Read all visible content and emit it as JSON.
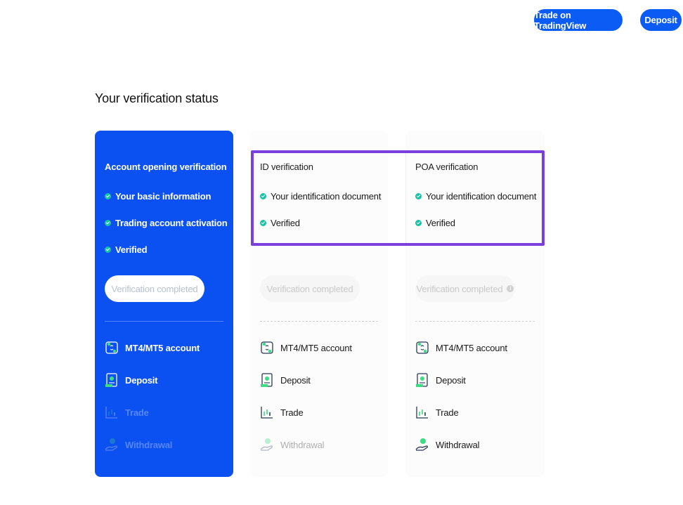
{
  "header": {
    "trade_button_label": "Trade on TradingView",
    "deposit_button_label": "Deposit"
  },
  "page": {
    "title": "Your verification status"
  },
  "cards": [
    {
      "title": "Account opening verification",
      "checks": [
        "Your basic information",
        "Trading account activation",
        "Verified"
      ],
      "status": "Verification completed",
      "steps": [
        "MT4/MT5 account",
        "Deposit",
        "Trade",
        "Withdrawal"
      ]
    },
    {
      "title": "ID verification",
      "checks": [
        "Your identification document",
        "Verified"
      ],
      "status": "Verification completed",
      "steps": [
        "MT4/MT5 account",
        "Deposit",
        "Trade",
        "Withdrawal"
      ]
    },
    {
      "title": "POA verification",
      "checks": [
        "Your identification document",
        "Verified"
      ],
      "status": "Verification completed",
      "status_info_icon": "i",
      "steps": [
        "MT4/MT5 account",
        "Deposit",
        "Trade",
        "Withdrawal"
      ]
    }
  ],
  "colors": {
    "brand_blue": "#0b50f0",
    "button_blue": "#0b5cf5",
    "check_green": "#17c3a6",
    "highlight_purple": "#7b3fe0"
  }
}
